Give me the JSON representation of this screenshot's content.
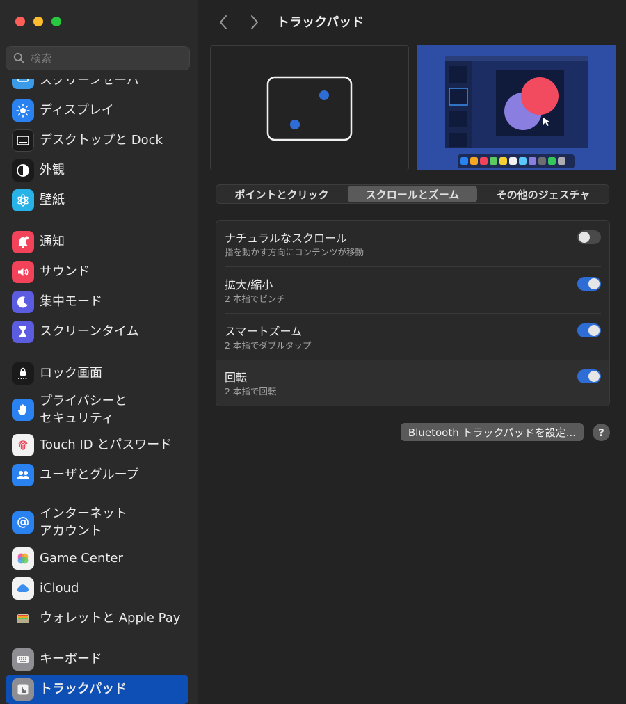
{
  "window": {
    "title": "トラックパッド"
  },
  "search": {
    "placeholder": "検索"
  },
  "sidebar": {
    "items": [
      {
        "label": "スクリーンセーバ",
        "icon": "screensaver-icon",
        "color": "#3b9be8"
      },
      {
        "label": "ディスプレイ",
        "icon": "display-brightness-icon",
        "color": "#2a82f0"
      },
      {
        "label": "デスクトップと Dock",
        "icon": "desktop-dock-icon",
        "color": "#1a1a1a"
      },
      {
        "label": "外観",
        "icon": "appearance-icon",
        "color": "#1a1a1a"
      },
      {
        "label": "壁紙",
        "icon": "wallpaper-icon",
        "color": "#27b3e8"
      },
      {
        "label": "通知",
        "icon": "notification-bell-icon",
        "color": "#f2435a"
      },
      {
        "label": "サウンド",
        "icon": "speaker-icon",
        "color": "#f2435a"
      },
      {
        "label": "集中モード",
        "icon": "moon-icon",
        "color": "#5c5ce0"
      },
      {
        "label": "スクリーンタイム",
        "icon": "hourglass-icon",
        "color": "#5c5ce0"
      },
      {
        "label": "ロック画面",
        "icon": "lock-screen-icon",
        "color": "#1a1a1a"
      },
      {
        "label": "プライバシーと\nセキュリティ",
        "label_line1": "プライバシーと",
        "label_line2": "セキュリティ",
        "icon": "hand-icon",
        "color": "#2a82f0"
      },
      {
        "label": "Touch ID とパスワード",
        "icon": "fingerprint-icon",
        "color": "#f2f2f2"
      },
      {
        "label": "ユーザとグループ",
        "icon": "users-icon",
        "color": "#2a82f0"
      },
      {
        "label_line1": "インターネット",
        "label_line2": "アカウント",
        "icon": "at-sign-icon",
        "color": "#2a82f0"
      },
      {
        "label": "Game Center",
        "icon": "game-center-icon",
        "color": "#f2f2f2"
      },
      {
        "label": "iCloud",
        "icon": "icloud-icon",
        "color": "#f2f2f2"
      },
      {
        "label": "ウォレットと Apple Pay",
        "icon": "wallet-icon",
        "color": "#2a2a2a"
      },
      {
        "label": "キーボード",
        "icon": "keyboard-icon",
        "color": "#8e8e93"
      },
      {
        "label": "トラックパッド",
        "icon": "trackpad-icon",
        "color": "#8e8e93",
        "active": true
      }
    ]
  },
  "tabs": [
    "ポイントとクリック",
    "スクロールとズーム",
    "その他のジェスチャ"
  ],
  "selected_tab": "スクロールとズーム",
  "settings": [
    {
      "title": "ナチュラルなスクロール",
      "subtitle": "指を動かす方向にコンテンツが移動",
      "enabled": false
    },
    {
      "title": "拡大/縮小",
      "subtitle": "2 本指でピンチ",
      "enabled": true
    },
    {
      "title": "スマートズーム",
      "subtitle": "2 本指でダブルタップ",
      "enabled": true
    },
    {
      "title": "回転",
      "subtitle": "2 本指で回転",
      "enabled": true
    }
  ],
  "bluetooth_button": "Bluetooth トラックパッドを設定...",
  "help_label": "?",
  "colors": {
    "accent": "#2f6dd6",
    "sidebar_active": "#0e4fb5"
  }
}
